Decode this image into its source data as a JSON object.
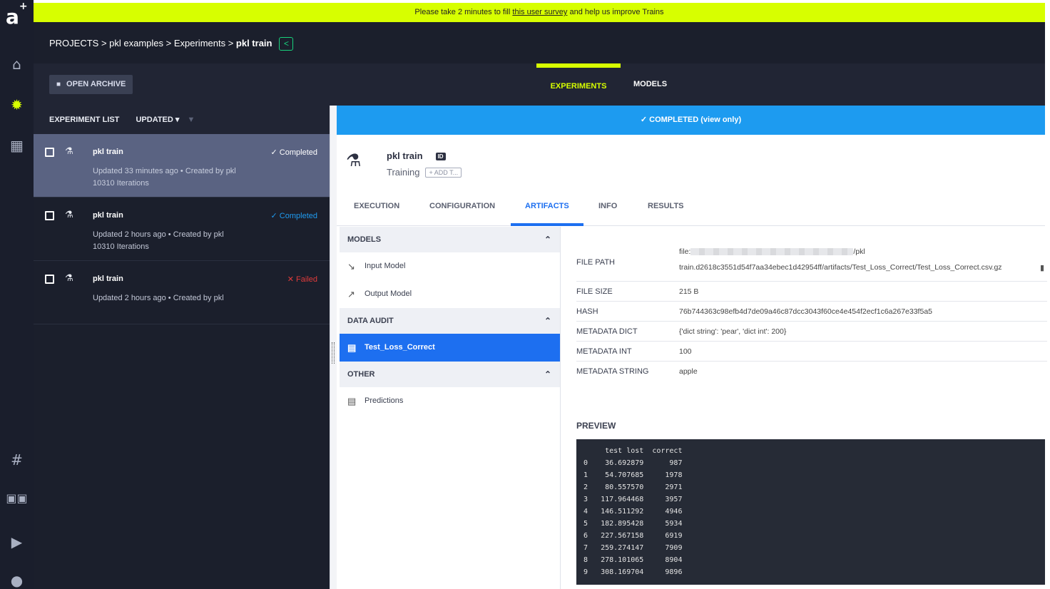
{
  "app": {
    "logo": "a",
    "logo_sup": "+"
  },
  "rail_icons": [
    "home-icon",
    "brain-icon",
    "server-icon",
    "slack-icon",
    "docs-icon",
    "youtube-icon",
    "github-icon"
  ],
  "banner": {
    "prefix": "Please take 2 minutes to fill ",
    "link": "this user survey",
    "suffix": " and help us improve Trains"
  },
  "breadcrumb": {
    "prefix": "PROJECTS > pkl examples > Experiments > ",
    "current": "pkl train"
  },
  "subbar": {
    "archive": "OPEN ARCHIVE",
    "tabs": [
      "EXPERIMENTS",
      "MODELS"
    ]
  },
  "list": {
    "title": "EXPERIMENT LIST",
    "sort": "UPDATED",
    "rows": [
      {
        "name": "pkl train",
        "sub1": "Updated 33 minutes ago • Created by pkl",
        "sub2": "10310 Iterations",
        "status": "✓ Completed"
      },
      {
        "name": "pkl train",
        "sub1": "Updated 2 hours ago • Created by pkl",
        "sub2": "10310 Iterations",
        "status": "✓ Completed"
      },
      {
        "name": "pkl train",
        "sub1": "Updated 2 hours ago • Created by pkl",
        "sub2": "",
        "status": "✕ Failed"
      }
    ]
  },
  "detail": {
    "status": "✓ COMPLETED (view only)",
    "name": "pkl train",
    "id_badge": "ID",
    "type": "Training",
    "add_tag": "+ ADD T...",
    "tabs": [
      "EXECUTION",
      "CONFIGURATION",
      "ARTIFACTS",
      "INFO",
      "RESULTS"
    ]
  },
  "artifacts": {
    "sections": [
      {
        "title": "MODELS",
        "items": [
          "Input Model",
          "Output Model"
        ]
      },
      {
        "title": "DATA AUDIT",
        "items": [
          "Test_Loss_Correct"
        ]
      },
      {
        "title": "OTHER",
        "items": [
          "Predictions"
        ]
      }
    ]
  },
  "meta": {
    "file_path_label": "FILE PATH",
    "file_path_line1_prefix": "file:",
    "file_path_line1_suffix": "/pkl",
    "file_path_line2": "train.d2618c3551d54f7aa34ebec1d42954ff/artifacts/Test_Loss_Correct/Test_Loss_Correct.csv.gz",
    "rows": [
      {
        "k": "FILE SIZE",
        "v": "215 B"
      },
      {
        "k": "HASH",
        "v": "76b744363c98efb4d7de09a46c87dcc3043f60ce4e454f2ecf1c6a267e33f5a5"
      },
      {
        "k": "METADATA DICT",
        "v": "{'dict string': 'pear', 'dict int': 200}"
      },
      {
        "k": "METADATA INT",
        "v": "100"
      },
      {
        "k": "METADATA STRING",
        "v": "apple"
      }
    ]
  },
  "preview": {
    "title": "PREVIEW",
    "text": "     test lost  correct\n0    36.692879      987\n1    54.707685     1978\n2    80.557570     2971\n3   117.964468     3957\n4   146.511292     4946\n5   182.895428     5934\n6   227.567158     6919\n7   259.274147     7909\n8   278.101065     8904\n9   308.169704     9896"
  }
}
